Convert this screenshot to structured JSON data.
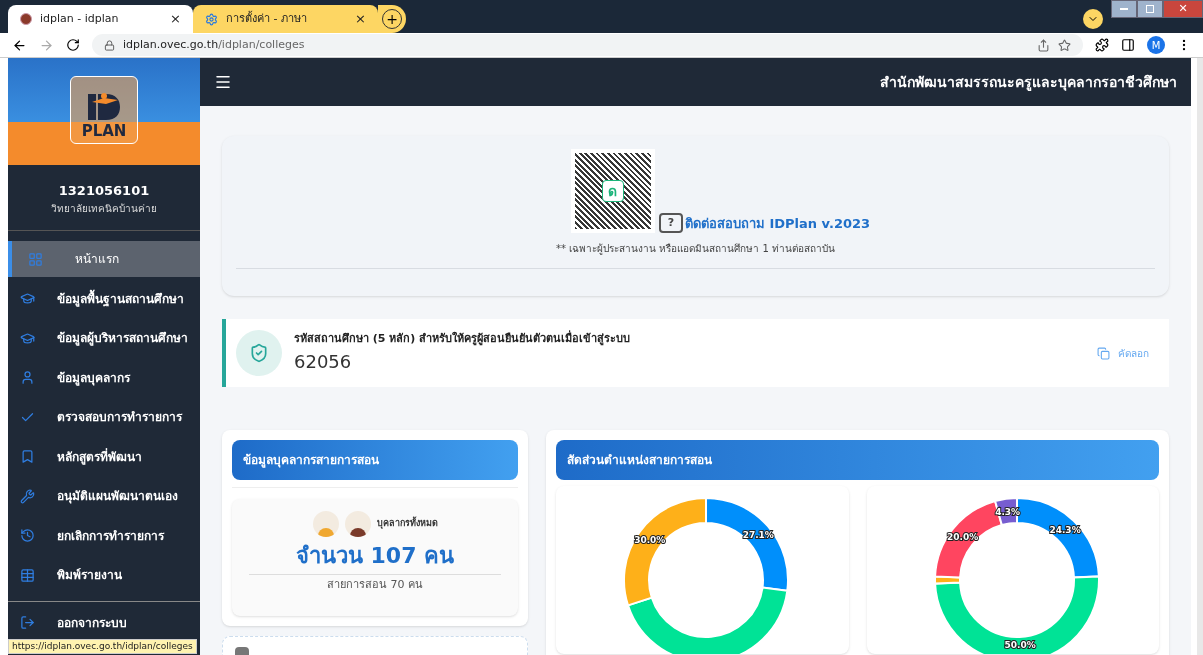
{
  "browser": {
    "tabs": [
      {
        "title": "idplan - idplan",
        "close": "×",
        "selected": true
      },
      {
        "title": "การตั้งค่า - ภาษา",
        "close": "×",
        "selected": false
      }
    ],
    "new_tab": "+",
    "url_host": "idplan.ovec.go.th",
    "url_path": "/idplan/colleges",
    "profile": "M",
    "window_close": "✕"
  },
  "sidebar": {
    "code": "1321056101",
    "school": "วิทยาลัยเทคนิคบ้านค่าย",
    "logo_text": "PLAN",
    "items": [
      {
        "label": "หน้าแรก",
        "selected": true
      },
      {
        "label": "ข้อมูลพื้นฐานสถานศึกษา",
        "selected": false
      },
      {
        "label": "ข้อมูลผู้บริหารสถานศึกษา",
        "selected": false
      },
      {
        "label": "ข้อมูลบุคลากร",
        "selected": false
      },
      {
        "label": "ตรวจสอบการทำรายการ",
        "selected": false
      },
      {
        "label": "หลักสูตรที่พัฒนา",
        "selected": false
      },
      {
        "label": "อนุมัติแผนพัฒนาตนเอง",
        "selected": false
      },
      {
        "label": "ยกเลิกการทำรายการ",
        "selected": false
      },
      {
        "label": "พิมพ์รายงาน",
        "selected": false
      }
    ],
    "logout": "ออกจากระบบ"
  },
  "header": {
    "title": "สำนักพัฒนาสมรรถนะครูและบุคลากรอาชีวศึกษา"
  },
  "contact": {
    "qr_letter": "ด",
    "help": "?",
    "link": "ติดต่อสอบถาม IDPlan v.2023",
    "note": "** เฉพาะผู้ประสานงาน หรือแอดมินสถานศึกษา 1 ท่านต่อสถาบัน"
  },
  "code_card": {
    "label": "รหัสสถานศึกษา (5 หลัก) สำหรับให้ครูผู้สอนยืนยันตัวตนเมื่อเข้าสู่ระบบ",
    "value": "62056",
    "copy": "คัดลอก"
  },
  "staff_card": {
    "title": "ข้อมูลบุคลากรสายการสอน",
    "caption": "บุคลากรทั้งหมด",
    "total": "จำนวน 107 คน",
    "sub": "สายการสอน 70 คน"
  },
  "ratio_card": {
    "title": "สัดส่วนตำแหน่งสายการสอน",
    "charts": [
      {
        "chart_data": {
          "type": "donut",
          "values": [
            27.1,
            42.9,
            30.0
          ],
          "colors": [
            "#008ffb",
            "#00e396",
            "#feb019"
          ],
          "value_labels": [
            "27.1%",
            null,
            "30.0%"
          ]
        }
      },
      {
        "chart_data": {
          "type": "donut",
          "values": [
            24.3,
            50.0,
            1.4,
            20.0,
            4.3
          ],
          "colors": [
            "#008ffb",
            "#00e396",
            "#feb019",
            "#ff4560",
            "#775dd0"
          ],
          "value_labels": [
            "24.3%",
            "50.0%",
            null,
            "20.0%",
            "4.3%"
          ]
        }
      }
    ]
  },
  "status_url": "https://idplan.ovec.go.th/idplan/colleges"
}
